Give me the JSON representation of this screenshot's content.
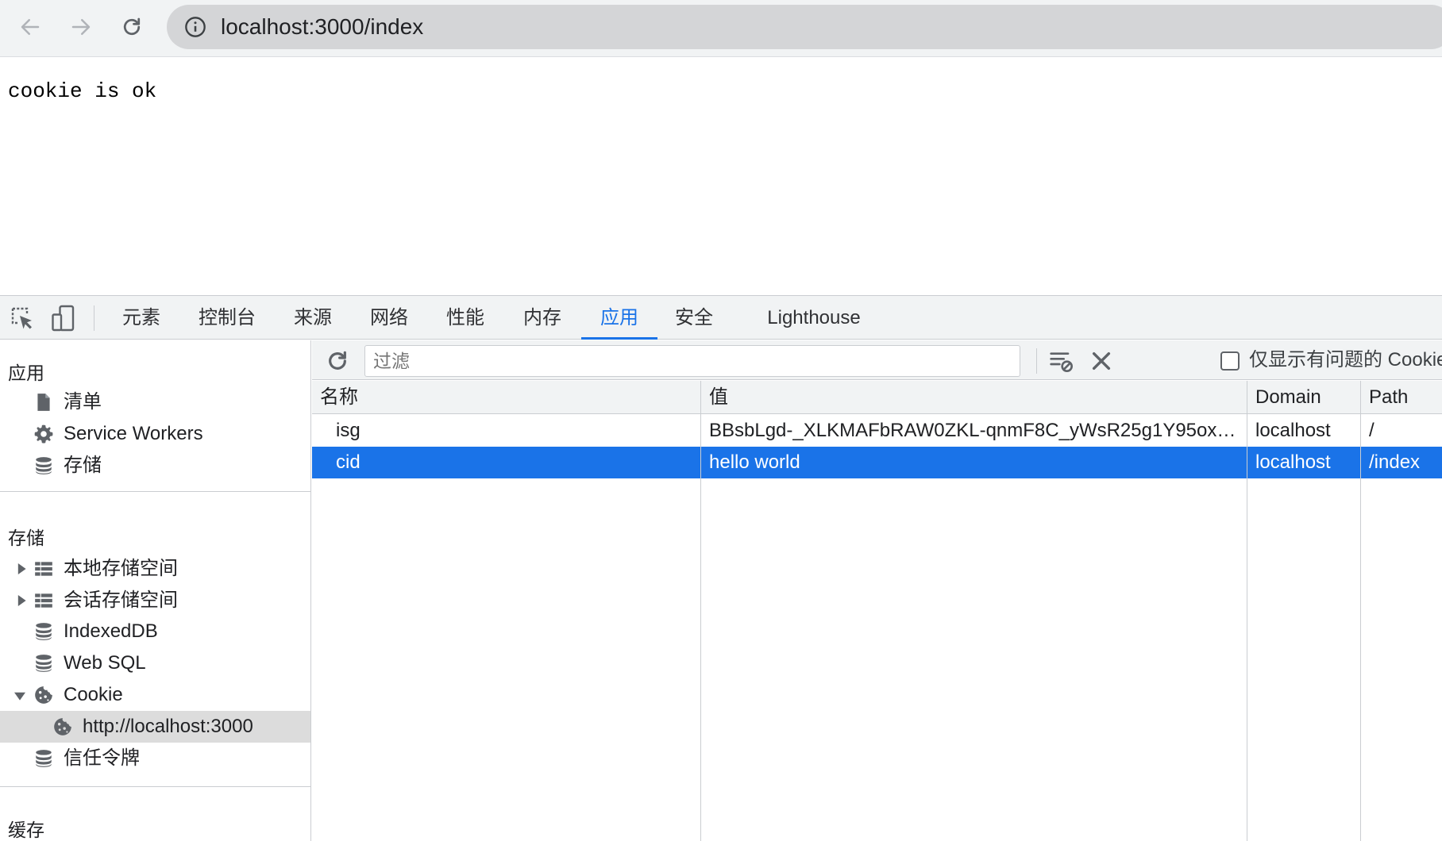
{
  "browser": {
    "url": "localhost:3000/index"
  },
  "page": {
    "body_text": "cookie is ok"
  },
  "devtools": {
    "tabs": [
      {
        "label": "元素"
      },
      {
        "label": "控制台"
      },
      {
        "label": "来源"
      },
      {
        "label": "网络"
      },
      {
        "label": "性能"
      },
      {
        "label": "内存"
      },
      {
        "label": "应用",
        "active": true
      },
      {
        "label": "安全"
      },
      {
        "label": "Lighthouse"
      }
    ],
    "accent_color": "#1a73e8"
  },
  "sidebar": {
    "section_app": "应用",
    "app_items": [
      {
        "label": "清单",
        "icon": "document-icon"
      },
      {
        "label": "Service Workers",
        "icon": "gear-icon"
      },
      {
        "label": "存储",
        "icon": "database-icon"
      }
    ],
    "section_storage": "存储",
    "storage_items": [
      {
        "label": "本地存储空间",
        "icon": "grid-icon",
        "arrow": "collapsed"
      },
      {
        "label": "会话存储空间",
        "icon": "grid-icon",
        "arrow": "collapsed"
      },
      {
        "label": "IndexedDB",
        "icon": "database-icon"
      },
      {
        "label": "Web SQL",
        "icon": "database-icon"
      },
      {
        "label": "Cookie",
        "icon": "cookie-icon",
        "arrow": "expanded"
      },
      {
        "label": "http://localhost:3000",
        "icon": "cookie-icon",
        "selected": true
      },
      {
        "label": "信任令牌",
        "icon": "database-icon"
      }
    ],
    "section_cache": "缓存"
  },
  "cookies": {
    "filter_placeholder": "过滤",
    "only_issues_label": "仅显示有问题的 Cookie",
    "columns": [
      "名称",
      "值",
      "Domain",
      "Path"
    ],
    "rows": [
      {
        "name": "isg",
        "value": "BBsbLgd-_XLKMAFbRAW0ZKL-qnmF8C_yWsR25g1Y95ox…",
        "domain": "localhost",
        "path": "/"
      },
      {
        "name": "cid",
        "value": "hello world",
        "domain": "localhost",
        "path": "/index",
        "selected": true
      }
    ]
  }
}
